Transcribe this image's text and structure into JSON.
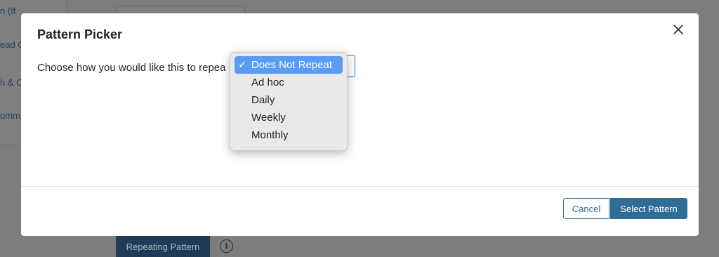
{
  "background": {
    "sidebar_fragments": [
      "n (If",
      "ead C",
      "h & C",
      "omm"
    ],
    "repeat_button_label": "Repeating Pattern",
    "info_icon_glyph": "i"
  },
  "modal": {
    "title": "Pattern Picker",
    "prompt": "Choose how you would like this to repea",
    "select": {
      "selected": "Does Not Repeat",
      "options": [
        "Does Not Repeat",
        "Ad hoc",
        "Daily",
        "Weekly",
        "Monthly"
      ]
    },
    "cancel_label": "Cancel",
    "confirm_label": "Select Pattern"
  },
  "icons": {
    "close": "close-icon",
    "check": "checkmark-icon",
    "info": "info-icon"
  },
  "colors": {
    "accent": "#2f6d96",
    "dropdown_highlight": "#5a9cf3"
  }
}
